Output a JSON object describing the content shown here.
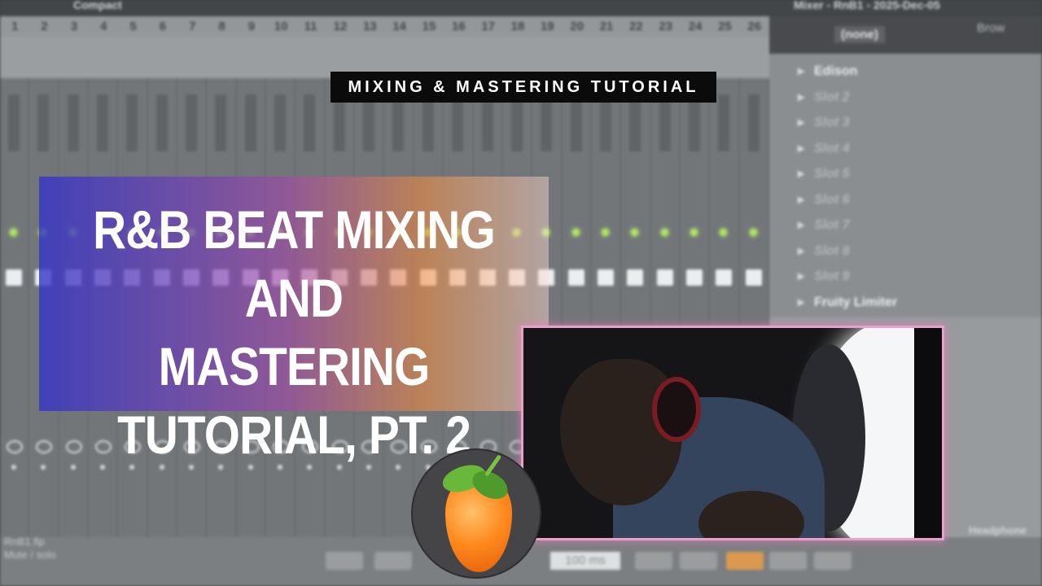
{
  "daw": {
    "window_title": "Compact",
    "mixer_title": "Mixer - RnB1 - 2025-Dec-05",
    "channel_numbers": [
      "1",
      "2",
      "3",
      "4",
      "5",
      "6",
      "7",
      "8",
      "9",
      "10",
      "11",
      "12",
      "13",
      "14",
      "15",
      "16",
      "17",
      "18",
      "19",
      "20",
      "21",
      "22",
      "23",
      "24",
      "25",
      "26"
    ],
    "slot_selector": "(none)",
    "browse_label": "Brow",
    "slots": [
      "Edison",
      "Slot 2",
      "Slot 3",
      "Slot 4",
      "Slot 5",
      "Slot 6",
      "Slot 7",
      "Slot 8",
      "Slot 9",
      "Fruity Limiter"
    ],
    "file_name": "RnB1.flp",
    "mode_label": "Mute / solo",
    "percent_display": "100 ms",
    "output_label": "Headphone"
  },
  "overlay": {
    "tag": "MIXING & MASTERING TUTORIAL",
    "title_lines": [
      "R&B BEAT MIXING AND",
      "MASTERING",
      "TUTORIAL, PT. 2"
    ],
    "title_gradient": [
      "#3434c8",
      "#a046aa",
      "#f58c3c",
      "#ffdcd7"
    ],
    "webcam_border": "#e6a2c8",
    "logo_icon": "fl-studio-fruit-icon"
  }
}
